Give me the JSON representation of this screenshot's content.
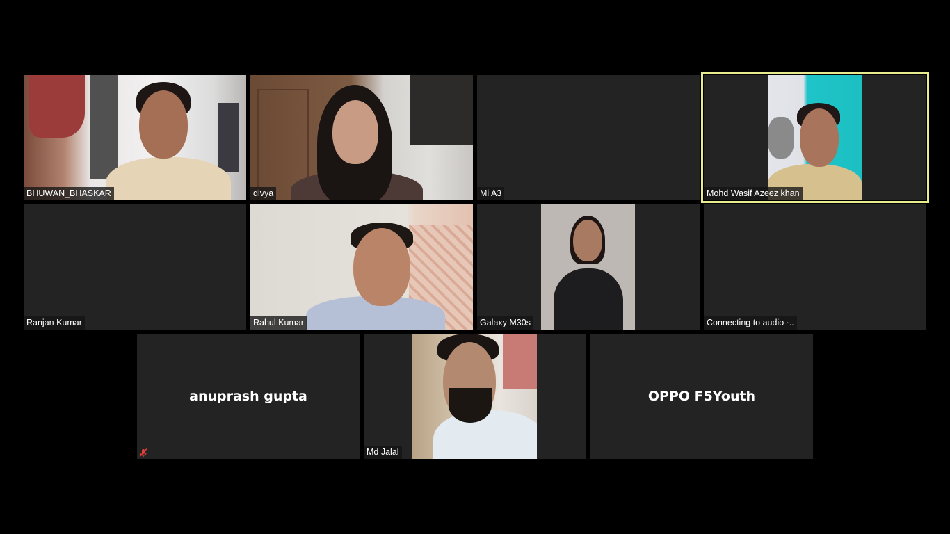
{
  "meeting": {
    "layout": "gallery",
    "active_speaker_color": "#e8ec8e",
    "participants": [
      {
        "name": "BHUWAN_BHASKAR",
        "video": true
      },
      {
        "name": "divya",
        "video": true
      },
      {
        "name": "Mi A3",
        "video": false
      },
      {
        "name": "Mohd Wasif Azeez khan",
        "video": true,
        "active_speaker": true
      },
      {
        "name": "Ranjan Kumar",
        "video": false
      },
      {
        "name": "Rahul Kumar",
        "video": true
      },
      {
        "name": "Galaxy M30s",
        "video": true
      },
      {
        "name": "Connecting to audio ·..",
        "video": false
      },
      {
        "name": "anuprash gupta",
        "video": false,
        "muted": true,
        "mute_icon": "microphone-muted-icon"
      },
      {
        "name": "Md Jalal",
        "video": true
      },
      {
        "name": "OPPO F5Youth",
        "video": false
      }
    ]
  }
}
